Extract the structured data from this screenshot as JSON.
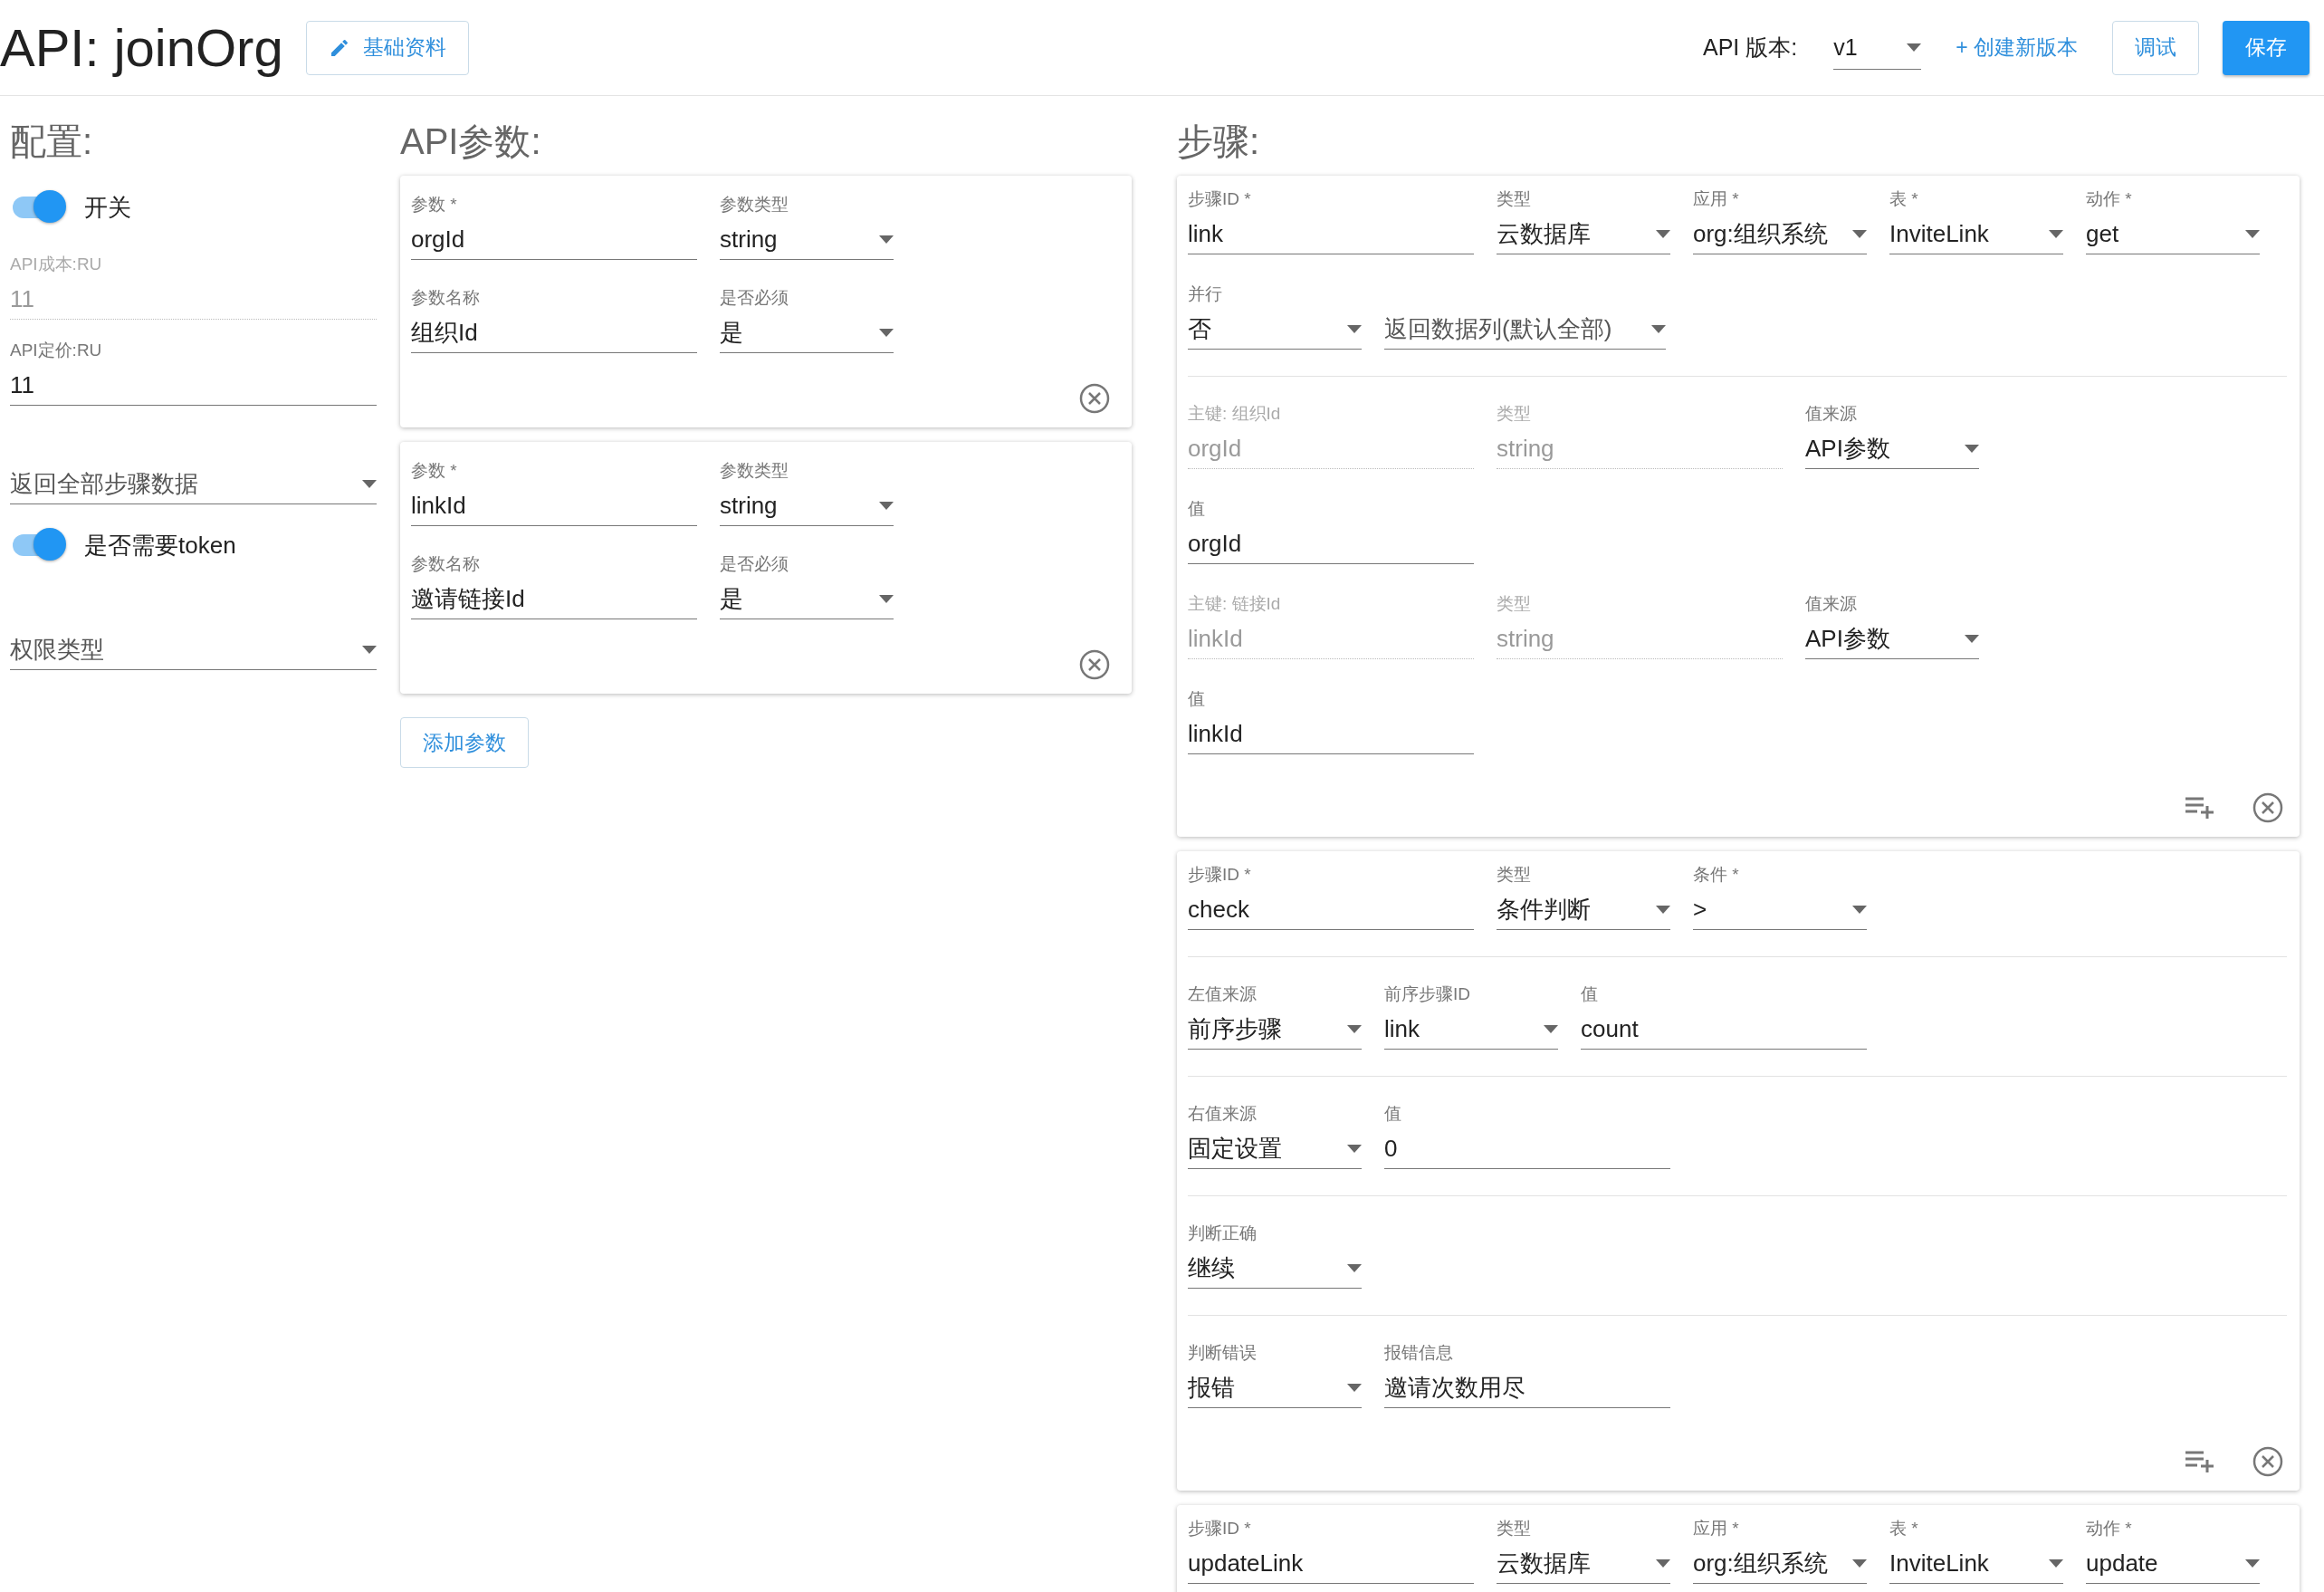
{
  "header": {
    "title": "API: joinOrg",
    "info_button": "基础资料",
    "version_label": "API 版本:",
    "version": "v1",
    "create_version": "+ 创建新版本",
    "debug_button": "调试",
    "save_button": "保存"
  },
  "config": {
    "heading": "配置:",
    "items": [
      {
        "kind": "switch",
        "label": "开关",
        "on": true
      },
      {
        "kind": "text",
        "label": "API成本:RU",
        "value": "11",
        "disabled": true
      },
      {
        "kind": "text",
        "label": "API定价:RU",
        "value": "11",
        "disabled": false
      },
      {
        "kind": "select",
        "placeholder": "返回全部步骤数据"
      },
      {
        "kind": "switch",
        "label": "是否需要token",
        "on": true
      },
      {
        "kind": "select",
        "placeholder": "权限类型"
      }
    ]
  },
  "params": {
    "heading": "API参数:",
    "cards": [
      {
        "rows": [
          [
            {
              "kind": "text",
              "label": "参数 *",
              "value": "orgId"
            },
            {
              "kind": "select",
              "label": "参数类型",
              "value": "string"
            }
          ],
          [
            {
              "kind": "text",
              "label": "参数名称",
              "value": "组织Id"
            },
            {
              "kind": "select",
              "label": "是否必须",
              "value": "是"
            }
          ]
        ]
      },
      {
        "rows": [
          [
            {
              "kind": "text",
              "label": "参数 *",
              "value": "linkId"
            },
            {
              "kind": "select",
              "label": "参数类型",
              "value": "string"
            }
          ],
          [
            {
              "kind": "text",
              "label": "参数名称",
              "value": "邀请链接Id"
            },
            {
              "kind": "select",
              "label": "是否必须",
              "value": "是"
            }
          ]
        ]
      }
    ],
    "add_button": "添加参数"
  },
  "steps": {
    "heading": "步骤:",
    "cards": [
      {
        "sections": [
          {
            "rows": [
              [
                {
                  "kind": "text",
                  "label": "步骤ID *",
                  "value": "link"
                },
                {
                  "kind": "select",
                  "label": "类型",
                  "value": "云数据库"
                },
                {
                  "kind": "select",
                  "label": "应用 *",
                  "value": "org:组织系统"
                },
                {
                  "kind": "select",
                  "label": "表 *",
                  "value": "InviteLink"
                },
                {
                  "kind": "select",
                  "label": "动作 *",
                  "value": "get"
                }
              ],
              [
                {
                  "kind": "select",
                  "label": "并行",
                  "value": "否"
                },
                {
                  "kind": "select",
                  "placeholder": "返回数据列(默认全部)"
                }
              ]
            ]
          },
          {
            "rows": [
              [
                {
                  "kind": "text",
                  "label": "主键: 组织Id",
                  "value": "orgId",
                  "disabled": true
                },
                {
                  "kind": "text",
                  "label": "类型",
                  "value": "string",
                  "disabled": true
                },
                {
                  "kind": "select",
                  "label": "值来源",
                  "value": "API参数"
                }
              ],
              [
                {
                  "kind": "text",
                  "label": "值",
                  "value": "orgId"
                }
              ],
              [
                {
                  "kind": "text",
                  "label": "主键: 链接Id",
                  "value": "linkId",
                  "disabled": true
                },
                {
                  "kind": "text",
                  "label": "类型",
                  "value": "string",
                  "disabled": true
                },
                {
                  "kind": "select",
                  "label": "值来源",
                  "value": "API参数"
                }
              ],
              [
                {
                  "kind": "text",
                  "label": "值",
                  "value": "linkId"
                }
              ]
            ]
          }
        ]
      },
      {
        "sections": [
          {
            "rows": [
              [
                {
                  "kind": "text",
                  "label": "步骤ID *",
                  "value": "check"
                },
                {
                  "kind": "select",
                  "label": "类型",
                  "value": "条件判断"
                },
                {
                  "kind": "select",
                  "label": "条件 *",
                  "value": ">"
                }
              ]
            ]
          },
          {
            "rows": [
              [
                {
                  "kind": "select",
                  "label": "左值来源",
                  "value": "前序步骤"
                },
                {
                  "kind": "select",
                  "label": "前序步骤ID",
                  "value": "link"
                },
                {
                  "kind": "text",
                  "label": "值",
                  "value": "count"
                }
              ]
            ]
          },
          {
            "rows": [
              [
                {
                  "kind": "select",
                  "label": "右值来源",
                  "value": "固定设置"
                },
                {
                  "kind": "text",
                  "label": "值",
                  "value": "0"
                }
              ]
            ]
          },
          {
            "rows": [
              [
                {
                  "kind": "select",
                  "label": "判断正确",
                  "value": "继续"
                }
              ]
            ]
          },
          {
            "rows": [
              [
                {
                  "kind": "select",
                  "label": "判断错误",
                  "value": "报错"
                },
                {
                  "kind": "text",
                  "label": "报错信息",
                  "value": "邀请次数用尽"
                }
              ]
            ]
          }
        ]
      },
      {
        "sections": [
          {
            "rows": [
              [
                {
                  "kind": "text",
                  "label": "步骤ID *",
                  "value": "updateLink"
                },
                {
                  "kind": "select",
                  "label": "类型",
                  "value": "云数据库"
                },
                {
                  "kind": "select",
                  "label": "应用 *",
                  "value": "org:组织系统"
                },
                {
                  "kind": "select",
                  "label": "表 *",
                  "value": "InviteLink"
                },
                {
                  "kind": "select",
                  "label": "动作 *",
                  "value": "update"
                }
              ]
            ]
          }
        ]
      }
    ]
  }
}
